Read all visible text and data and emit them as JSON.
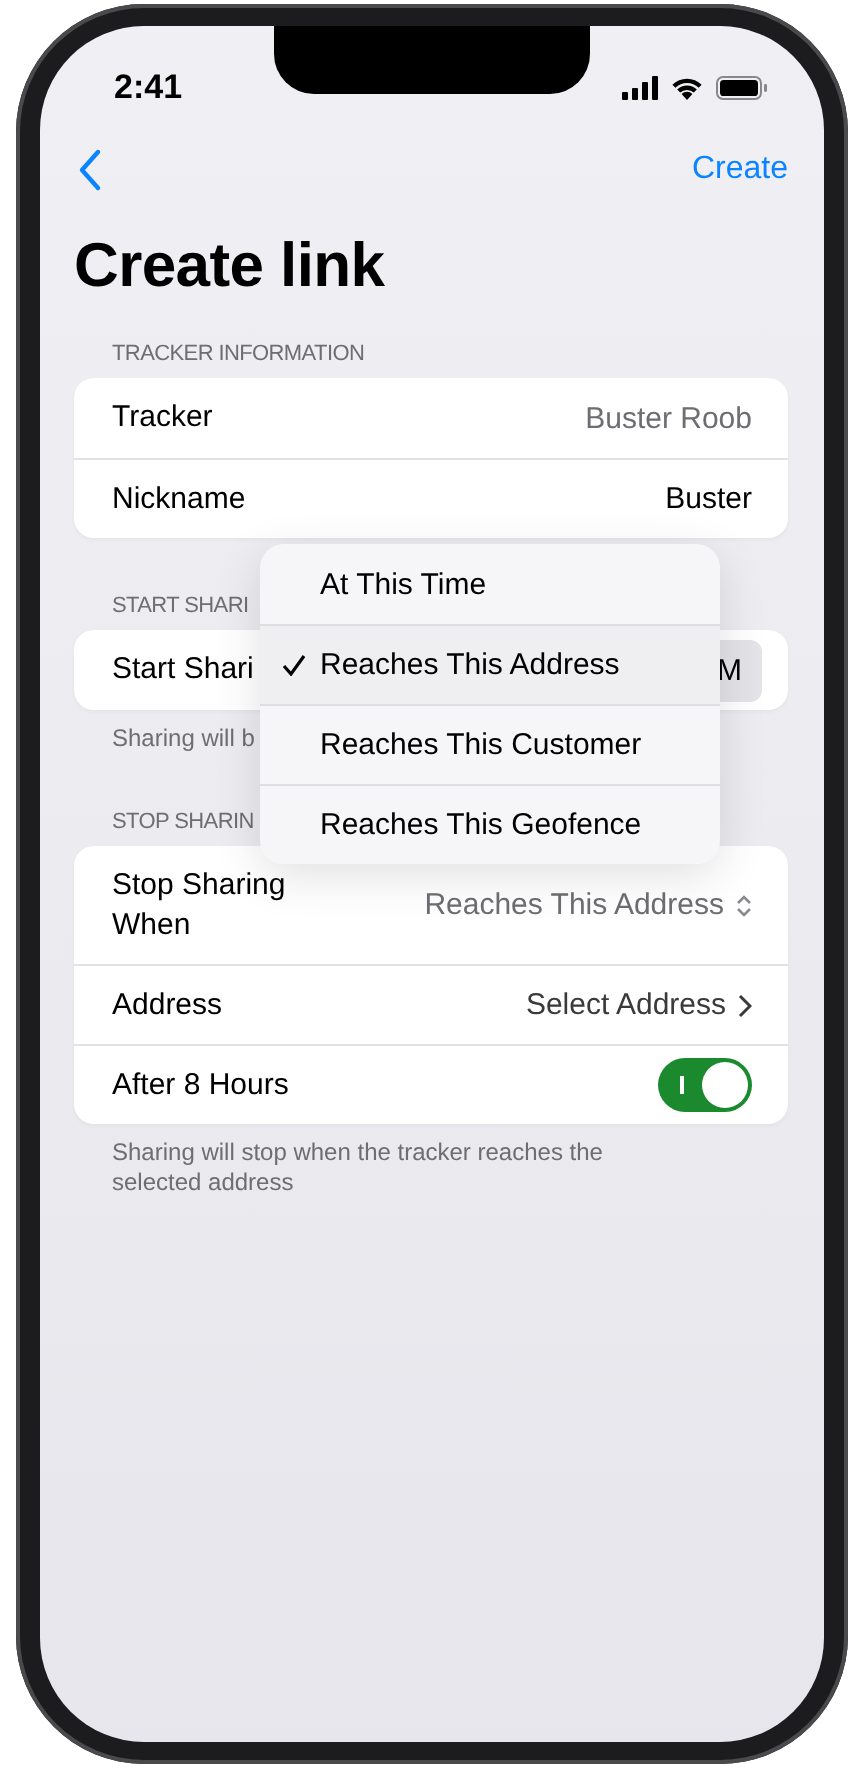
{
  "status_bar": {
    "time": "2:41"
  },
  "nav": {
    "action": "Create"
  },
  "title": "Create link",
  "sections": [
    {
      "header": "TRACKER INFORMATION",
      "rows": [
        {
          "kind": "value",
          "label": "Tracker",
          "value": "Buster Roob",
          "muted": true
        },
        {
          "kind": "value",
          "label": "Nickname",
          "value": "Buster",
          "muted": false
        }
      ]
    },
    {
      "header": "START SHARI",
      "rows": [
        {
          "kind": "pill",
          "label": "Start Shari",
          "value": "M"
        }
      ],
      "footer": "Sharing will b"
    },
    {
      "header": "STOP SHARIN",
      "rows": [
        {
          "kind": "popup",
          "label": "Stop Sharing When",
          "value": "Reaches This Address"
        },
        {
          "kind": "link",
          "label": "Address",
          "value": "Select Address"
        },
        {
          "kind": "toggle",
          "label": "After 8 Hours",
          "on": true
        }
      ],
      "footer": "Sharing will stop when the tracker reaches the selected address"
    }
  ],
  "menu": {
    "items": [
      {
        "label": "At This Time",
        "selected": false
      },
      {
        "label": "Reaches This Address",
        "selected": true
      },
      {
        "label": "Reaches This Customer",
        "selected": false
      },
      {
        "label": "Reaches This Geofence",
        "selected": false
      }
    ]
  }
}
